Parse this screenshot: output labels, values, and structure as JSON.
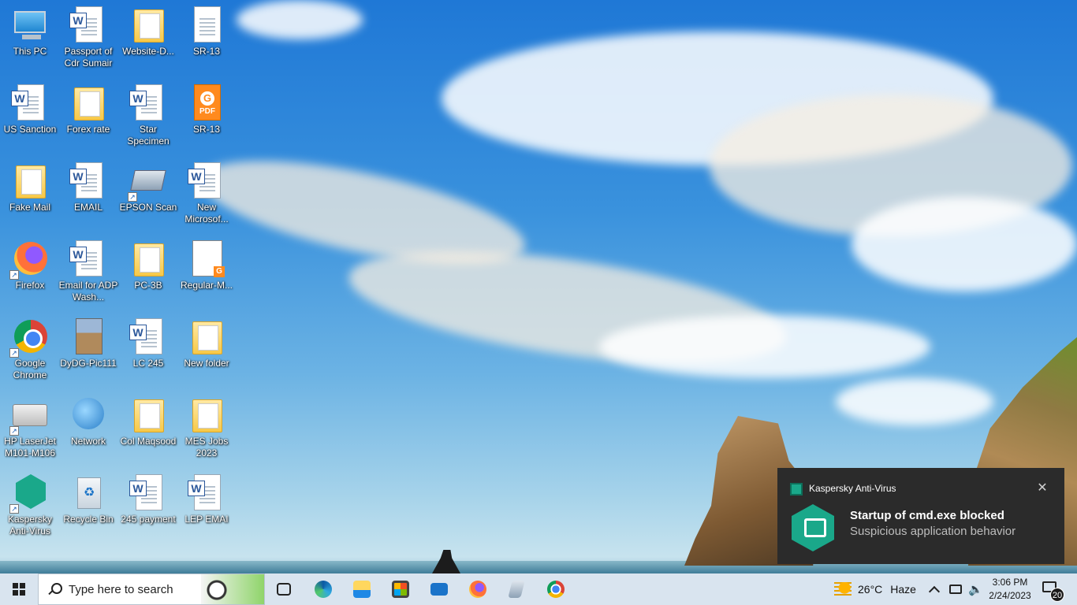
{
  "desktop": {
    "icons": [
      {
        "label": "This PC",
        "icon": "this-pc-icon",
        "kind": "pc"
      },
      {
        "label": "Passport of Cdr Sumair",
        "icon": "word-document-icon",
        "kind": "word"
      },
      {
        "label": "Website-D...",
        "icon": "folder-icon",
        "kind": "folder"
      },
      {
        "label": "SR-13",
        "icon": "text-document-icon",
        "kind": "doc"
      },
      {
        "label": "US Sanction",
        "icon": "word-document-icon",
        "kind": "word"
      },
      {
        "label": "Forex rate",
        "icon": "folder-icon",
        "kind": "folder"
      },
      {
        "label": "Star Specimen",
        "icon": "word-document-icon",
        "kind": "word"
      },
      {
        "label": "SR-13",
        "icon": "pdf-document-icon",
        "kind": "pdf"
      },
      {
        "label": "Fake Mail",
        "icon": "folder-icon",
        "kind": "folder"
      },
      {
        "label": "EMAIL",
        "icon": "word-document-icon",
        "kind": "word"
      },
      {
        "label": "EPSON Scan",
        "icon": "scanner-icon",
        "kind": "scan"
      },
      {
        "label": "New Microsof...",
        "icon": "word-document-icon",
        "kind": "word"
      },
      {
        "label": "Firefox",
        "icon": "firefox-icon",
        "kind": "ff"
      },
      {
        "label": "Email for ADP Wash...",
        "icon": "word-document-icon",
        "kind": "word"
      },
      {
        "label": "PC-3B",
        "icon": "folder-icon",
        "kind": "folder"
      },
      {
        "label": "Regular-M...",
        "icon": "form-document-icon",
        "kind": "form"
      },
      {
        "label": "Google Chrome",
        "icon": "chrome-icon",
        "kind": "chrome"
      },
      {
        "label": "DyDG-Pic111",
        "icon": "photo-icon",
        "kind": "photo"
      },
      {
        "label": "LC 245",
        "icon": "word-document-icon",
        "kind": "word"
      },
      {
        "label": "New folder",
        "icon": "folder-icon",
        "kind": "folder"
      },
      {
        "label": "HP LaserJet M101-M106",
        "icon": "printer-icon",
        "kind": "printer"
      },
      {
        "label": "Network",
        "icon": "network-icon",
        "kind": "globe"
      },
      {
        "label": "Col Maqsood",
        "icon": "folder-icon",
        "kind": "folder"
      },
      {
        "label": "MES Jobs 2023",
        "icon": "folder-icon",
        "kind": "folder"
      },
      {
        "label": "Kaspersky Anti-Virus",
        "icon": "kaspersky-icon",
        "kind": "kav"
      },
      {
        "label": "Recycle Bin",
        "icon": "recycle-bin-icon",
        "kind": "bin"
      },
      {
        "label": "245 payment",
        "icon": "word-document-icon",
        "kind": "word"
      },
      {
        "label": "LEP EMAI",
        "icon": "word-document-icon",
        "kind": "word"
      }
    ]
  },
  "taskbar": {
    "search_placeholder": "Type here to search",
    "pinned": [
      "task-view-icon",
      "edge-icon",
      "file-explorer-icon",
      "store-icon",
      "mail-icon",
      "firefox-icon",
      "scanner-icon",
      "chrome-icon"
    ],
    "weather_temp": "26°C",
    "weather_desc": "Haze",
    "time": "3:06 PM",
    "date": "2/24/2023",
    "notification_count": "20"
  },
  "toast": {
    "app_name": "Kaspersky Anti-Virus",
    "title": "Startup of cmd.exe blocked",
    "message": "Suspicious application behavior",
    "close_glyph": "✕"
  },
  "colors": {
    "taskbar_bg": "#d9e4ef",
    "toast_bg": "#2b2b2b",
    "kaspersky_green": "#1aa88a",
    "word_blue": "#2b579a"
  }
}
